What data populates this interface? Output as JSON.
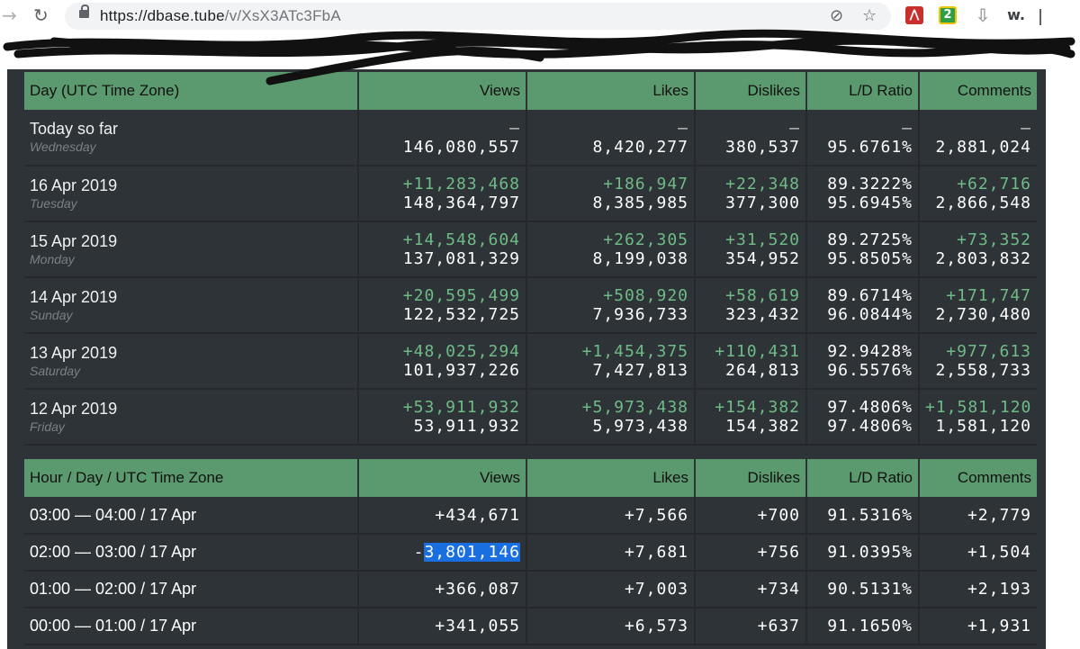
{
  "browser": {
    "url_host": "https://dbase.tube",
    "url_path": "/v/XsX3ATc3FbA",
    "extensions": {
      "acrobat": "Acrobat",
      "badge": "2",
      "w": "w."
    }
  },
  "daily_table": {
    "headers": [
      "Day (UTC Time Zone)",
      "Views",
      "Likes",
      "Dislikes",
      "L/D Ratio",
      "Comments"
    ],
    "rows": [
      {
        "day": "Today so far",
        "weekday": "Wednesday",
        "views_delta": "–",
        "views_total": "146,080,557",
        "likes_delta": "–",
        "likes_total": "8,420,277",
        "dislikes_delta": "–",
        "dislikes_total": "380,537",
        "ratio_delta": "–",
        "ratio_total": "95.6761%",
        "comments_delta": "–",
        "comments_total": "2,881,024"
      },
      {
        "day": "16 Apr 2019",
        "weekday": "Tuesday",
        "views_delta": "+11,283,468",
        "views_total": "148,364,797",
        "likes_delta": "+186,947",
        "likes_total": "8,385,985",
        "dislikes_delta": "+22,348",
        "dislikes_total": "377,300",
        "ratio_delta": "89.3222%",
        "ratio_total": "95.6945%",
        "comments_delta": "+62,716",
        "comments_total": "2,866,548"
      },
      {
        "day": "15 Apr 2019",
        "weekday": "Monday",
        "views_delta": "+14,548,604",
        "views_total": "137,081,329",
        "likes_delta": "+262,305",
        "likes_total": "8,199,038",
        "dislikes_delta": "+31,520",
        "dislikes_total": "354,952",
        "ratio_delta": "89.2725%",
        "ratio_total": "95.8505%",
        "comments_delta": "+73,352",
        "comments_total": "2,803,832"
      },
      {
        "day": "14 Apr 2019",
        "weekday": "Sunday",
        "views_delta": "+20,595,499",
        "views_total": "122,532,725",
        "likes_delta": "+508,920",
        "likes_total": "7,936,733",
        "dislikes_delta": "+58,619",
        "dislikes_total": "323,432",
        "ratio_delta": "89.6714%",
        "ratio_total": "96.0844%",
        "comments_delta": "+171,747",
        "comments_total": "2,730,480"
      },
      {
        "day": "13 Apr 2019",
        "weekday": "Saturday",
        "views_delta": "+48,025,294",
        "views_total": "101,937,226",
        "likes_delta": "+1,454,375",
        "likes_total": "7,427,813",
        "dislikes_delta": "+110,431",
        "dislikes_total": "264,813",
        "ratio_delta": "92.9428%",
        "ratio_total": "96.5576%",
        "comments_delta": "+977,613",
        "comments_total": "2,558,733"
      },
      {
        "day": "12 Apr 2019",
        "weekday": "Friday",
        "views_delta": "+53,911,932",
        "views_total": "53,911,932",
        "likes_delta": "+5,973,438",
        "likes_total": "5,973,438",
        "dislikes_delta": "+154,382",
        "dislikes_total": "154,382",
        "ratio_delta": "97.4806%",
        "ratio_total": "97.4806%",
        "comments_delta": "+1,581,120",
        "comments_total": "1,581,120"
      }
    ]
  },
  "hourly_table": {
    "headers": [
      "Hour / Day / UTC Time Zone",
      "Views",
      "Likes",
      "Dislikes",
      "L/D Ratio",
      "Comments"
    ],
    "rows": [
      {
        "hour": "03:00 — 04:00 / 17 Apr",
        "views_sign": "+",
        "views": "434,671",
        "likes": "+7,566",
        "dislikes": "+700",
        "ratio": "91.5316%",
        "comments": "+2,779"
      },
      {
        "hour": "02:00 — 03:00 / 17 Apr",
        "views_sign": "-",
        "views": "3,801,146",
        "likes": "+7,681",
        "dislikes": "+756",
        "ratio": "91.0395%",
        "comments": "+1,504"
      },
      {
        "hour": "01:00 — 02:00 / 17 Apr",
        "views_sign": "+",
        "views": "366,087",
        "likes": "+7,003",
        "dislikes": "+734",
        "ratio": "90.5131%",
        "comments": "+2,193"
      },
      {
        "hour": "00:00 — 01:00 / 17 Apr",
        "views_sign": "+",
        "views": "341,055",
        "likes": "+6,573",
        "dislikes": "+637",
        "ratio": "91.1650%",
        "comments": "+1,931"
      }
    ]
  }
}
